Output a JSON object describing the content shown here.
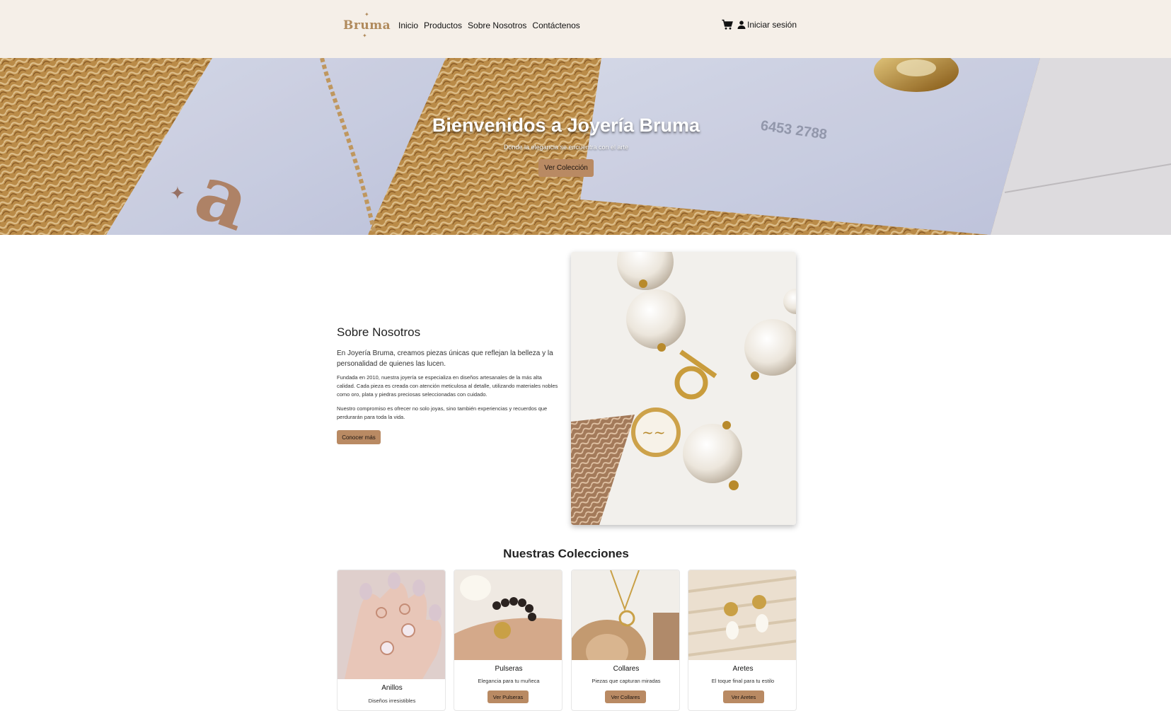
{
  "navbar": {
    "logo_text": "Bruma",
    "links": [
      "Inicio",
      "Productos",
      "Sobre Nosotros",
      "Contáctenos"
    ],
    "cart_icon": "cart-icon",
    "login_label": "Iniciar sesión",
    "login_icon": "user-icon"
  },
  "hero": {
    "title": "Bienvenidos a Joyería Bruma",
    "subtitle": "Donde la elegancia se encuentra con el arte",
    "button": "Ver Colección",
    "card_text": "6453 2788"
  },
  "about": {
    "title": "Sobre Nosotros",
    "lead": "En Joyería Bruma, creamos piezas únicas que reflejan la belleza y la personalidad de quienes las lucen.",
    "paragraph1": "Fundada en 2010, nuestra joyería se especializa en diseños artesanales de la más alta calidad. Cada pieza es creada con atención meticulosa al detalle, utilizando materiales nobles como oro, plata y piedras preciosas seleccionadas con cuidado.",
    "paragraph2": "Nuestro compromiso es ofrecer no solo joyas, sino también experiencias y recuerdos que perdurarán para toda la vida.",
    "button": "Conocer más"
  },
  "collections": {
    "title": "Nuestras Colecciones",
    "items": [
      {
        "title": "Anillos",
        "desc": "Diseños irresistibles",
        "button": ""
      },
      {
        "title": "Pulseras",
        "desc": "Elegancia para tu muñeca",
        "button": "Ver Pulseras"
      },
      {
        "title": "Collares",
        "desc": "Piezas que capturan miradas",
        "button": "Ver Collares"
      },
      {
        "title": "Aretes",
        "desc": "El toque final para tu estilo",
        "button": "Ver Aretes"
      }
    ]
  },
  "colors": {
    "navbar_bg": "#f5efe8",
    "accent": "#b98a63",
    "logo": "#b08a5c"
  }
}
